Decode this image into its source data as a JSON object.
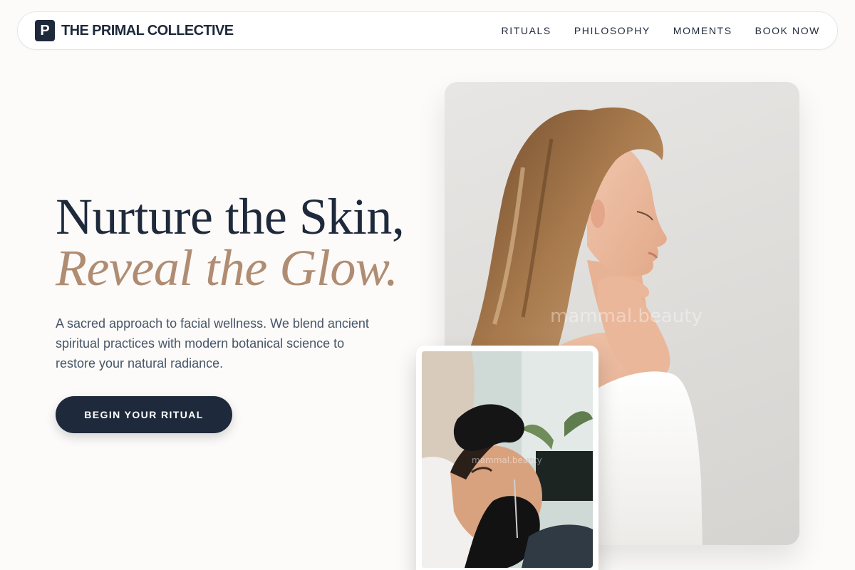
{
  "brand": {
    "mark": "P",
    "name": "THE PRIMAL COLLECTIVE"
  },
  "nav": {
    "links": [
      {
        "label": "RITUALS"
      },
      {
        "label": "PHILOSOPHY"
      },
      {
        "label": "MOMENTS"
      },
      {
        "label": "BOOK NOW"
      }
    ]
  },
  "hero": {
    "title_line1": "Nurture the Skin,",
    "title_line2": "Reveal the Glow.",
    "subtitle": "A sacred approach to facial wellness. We blend ancient spiritual practices with modern botanical science to restore your natural radiance.",
    "cta_label": "BEGIN YOUR RITUAL"
  },
  "images": {
    "main_watermark": "mammal.beauty",
    "small_watermark": "mammal.beauty"
  },
  "colors": {
    "primary": "#1e293b",
    "accent": "#b08c72",
    "background": "#fcfbf9",
    "body_text": "#475569"
  }
}
